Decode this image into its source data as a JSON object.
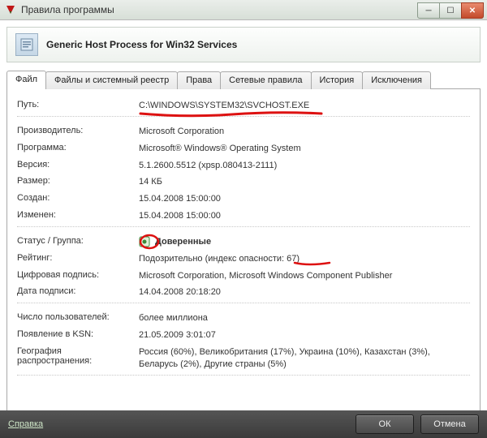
{
  "window": {
    "title": "Правила программы"
  },
  "header": {
    "title": "Generic Host Process for Win32 Services"
  },
  "tabs": {
    "t0": "Файл",
    "t1": "Файлы и системный реестр",
    "t2": "Права",
    "t3": "Сетевые правила",
    "t4": "История",
    "t5": "Исключения"
  },
  "labels": {
    "path": "Путь:",
    "vendor": "Производитель:",
    "program": "Программа:",
    "version": "Версия:",
    "size": "Размер:",
    "created": "Создан:",
    "modified": "Изменен:",
    "status": "Статус / Группа:",
    "rating": "Рейтинг:",
    "signature": "Цифровая подпись:",
    "signdate": "Дата подписи:",
    "users": "Число пользователей:",
    "ksn": "Появление в KSN:",
    "geo": "География распространения:"
  },
  "values": {
    "path": "C:\\WINDOWS\\SYSTEM32\\SVCHOST.EXE",
    "vendor": "Microsoft Corporation",
    "program": "Microsoft® Windows® Operating System",
    "version": "5.1.2600.5512 (xpsp.080413-2111)",
    "size": "14 КБ",
    "created": "15.04.2008 15:00:00",
    "modified": "15.04.2008 15:00:00",
    "status": "Доверенные",
    "rating": "Подозрительно (индекс опасности: 67)",
    "signature": "Microsoft Corporation, Microsoft Windows Component Publisher",
    "signdate": "14.04.2008 20:18:20",
    "users": "более миллиона",
    "ksn": "21.05.2009 3:01:07",
    "geo": "Россия (60%), Великобритания (17%), Украина (10%), Казахстан (3%), Беларусь (2%), Другие страны (5%)"
  },
  "footer": {
    "help": "Справка",
    "ok": "ОК",
    "cancel": "Отмена"
  }
}
